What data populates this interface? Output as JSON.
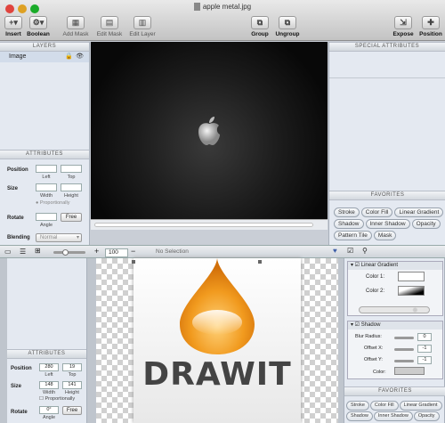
{
  "window": {
    "title": "apple metal.jpg"
  },
  "toolbar": {
    "insert": "Insert",
    "boolean": "Boolean",
    "add_mask": "Add Mask",
    "edit_mask": "Edit Mask",
    "edit_layer": "Edit Layer",
    "group": "Group",
    "ungroup": "Ungroup",
    "expose": "Expose",
    "position": "Position"
  },
  "layers": {
    "header": "LAYERS",
    "items": [
      {
        "name": "Image"
      }
    ]
  },
  "attributes": {
    "header": "ATTRIBUTES",
    "position_label": "Position",
    "left_label": "Left",
    "top_label": "Top",
    "size_label": "Size",
    "width_label": "Width",
    "height_label": "Height",
    "proportionally_label": "Proportionally",
    "rotate_label": "Rotate",
    "free_label": "Free",
    "angle_label": "Angle",
    "blending_label": "Blending",
    "blending_value": "Normal"
  },
  "attributes2": {
    "header": "ATTRIBUTES",
    "position_label": "Position",
    "left_value": "280",
    "top_value": "19",
    "left_label": "Left",
    "top_label": "Top",
    "size_label": "Size",
    "width_value": "148",
    "height_value": "141",
    "width_label": "Width",
    "height_label": "Height",
    "proportionally_label": "Proportionally",
    "rotate_label": "Rotate",
    "angle_value": "0°",
    "free_label": "Free",
    "angle_label": "Angle"
  },
  "special": {
    "header": "SPECIAL ATTRIBUTES"
  },
  "favorites": {
    "header": "FAVORITES",
    "row1": [
      "Stroke",
      "Color Fill",
      "Linear Gradient"
    ],
    "row2": [
      "Shadow",
      "Inner Shadow",
      "Opacity"
    ],
    "row3": [
      "Pattern Tile",
      "Mask"
    ]
  },
  "favorites2": {
    "header": "FAVORITES",
    "row1": [
      "Stroke",
      "Color Fill",
      "Linear Gradient"
    ],
    "row2": [
      "Shadow",
      "Inner Shadow",
      "Opacity"
    ]
  },
  "statusbar": {
    "zoom": "100",
    "selection": "No Selection"
  },
  "effects": {
    "linear_gradient_title": "Linear Gradient",
    "color1_label": "Color 1:",
    "color2_label": "Color 2:",
    "shadow_title": "Shadow",
    "blur_label": "Blur Radius:",
    "blur_value": "0",
    "offx_label": "Offset X:",
    "offx_value": "-1",
    "offy_label": "Offset Y:",
    "offy_value": "-1",
    "color_label": "Color:"
  },
  "artwork": {
    "text": "DRAWIT"
  },
  "colors": {
    "accent": "#3f7fd6",
    "panel": "#e4e9f1",
    "canvas_dark": "#0a0a0a",
    "drop": "#f19a1e"
  }
}
